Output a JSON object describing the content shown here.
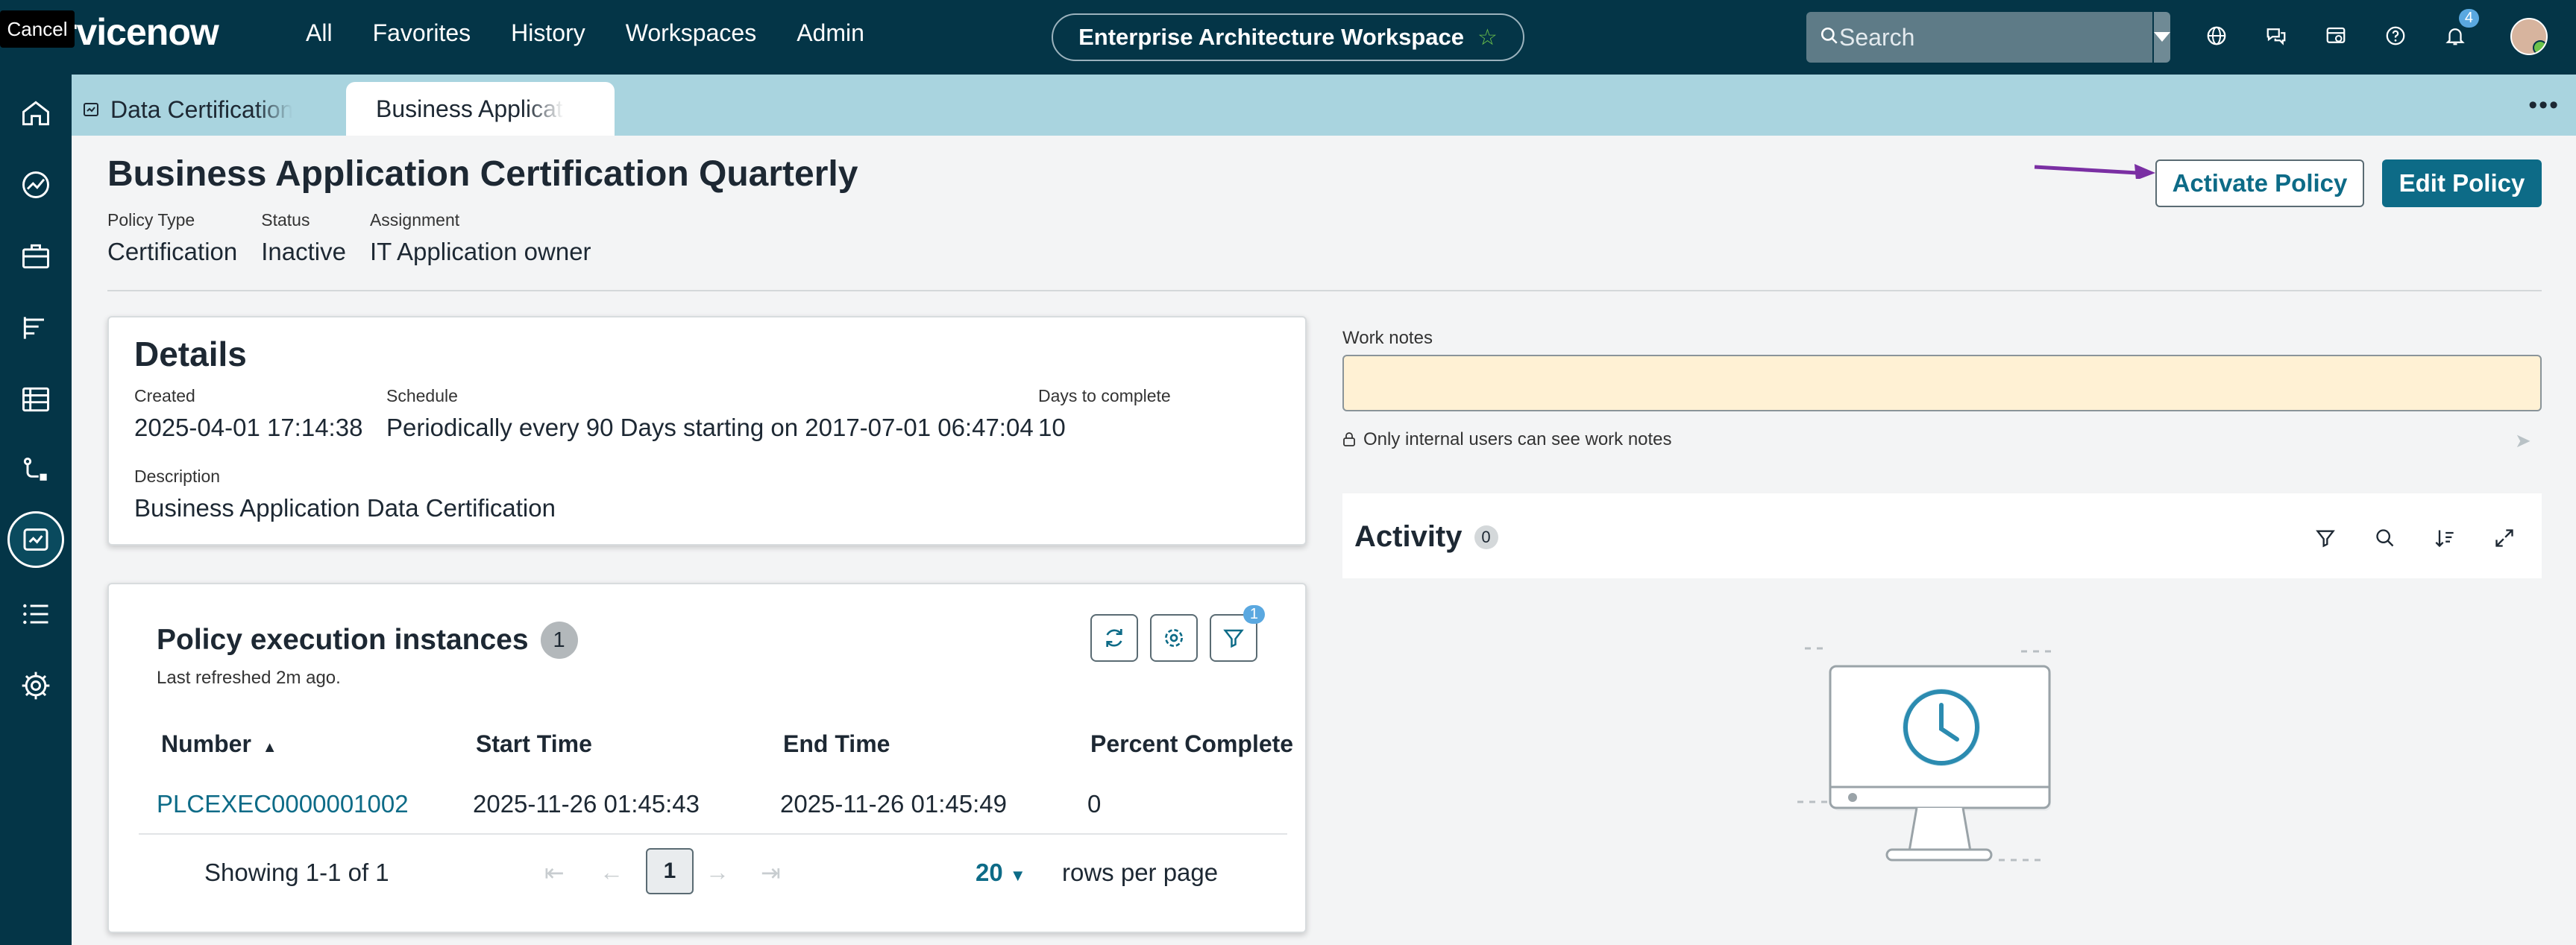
{
  "header": {
    "cancel_label": "Cancel",
    "logo": "rvicenow",
    "nav": [
      "All",
      "Favorites",
      "History",
      "Workspaces",
      "Admin"
    ],
    "workspace": "Enterprise Architecture Workspace",
    "search_placeholder": "Search",
    "notification_count": "4"
  },
  "tabs": [
    {
      "label": "Data Certification"
    },
    {
      "label": "Business Application"
    }
  ],
  "record": {
    "title": "Business Application Certification Quarterly",
    "meta": [
      {
        "label": "Policy Type",
        "value": "Certification"
      },
      {
        "label": "Status",
        "value": "Inactive"
      },
      {
        "label": "Assignment",
        "value": "IT Application owner"
      }
    ],
    "buttons": {
      "activate": "Activate Policy",
      "edit": "Edit Policy"
    }
  },
  "details": {
    "heading": "Details",
    "created": {
      "label": "Created",
      "value": "2025-04-01 17:14:38"
    },
    "schedule": {
      "label": "Schedule",
      "value": "Periodically every 90 Days starting on 2017-07-01 06:47:04"
    },
    "days": {
      "label": "Days to complete",
      "value": "10"
    },
    "description": {
      "label": "Description",
      "value": "Business Application Data Certification"
    }
  },
  "instances": {
    "heading": "Policy execution instances",
    "count": "1",
    "refreshed": "Last refreshed 2m ago.",
    "filter_count": "1",
    "columns": [
      "Number",
      "Start Time",
      "End Time",
      "Percent Complete"
    ],
    "rows": [
      {
        "number": "PLCEXEC0000001002",
        "start": "2025-11-26 01:45:43",
        "end": "2025-11-26 01:45:49",
        "percent": "0"
      }
    ],
    "showing": "Showing 1-1 of 1",
    "page": "1",
    "rows_per_page": "20",
    "rows_per_page_label": "rows per page"
  },
  "work_notes": {
    "label": "Work notes",
    "note": "Only internal users can see work notes"
  },
  "activity": {
    "heading": "Activity",
    "count": "0"
  },
  "colors": {
    "header": "#043547",
    "tabstrip": "#a9d4df",
    "primary": "#0d6b87",
    "arrow": "#7a2fa3"
  }
}
